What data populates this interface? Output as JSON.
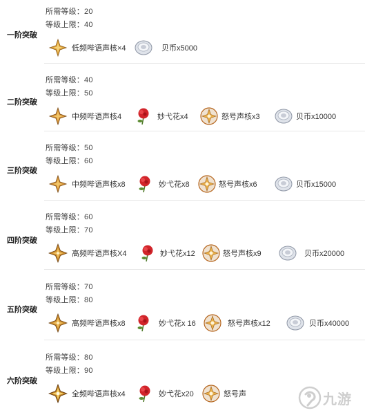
{
  "labels": {
    "level_prefix": "所需等级：",
    "cap_prefix": "等级上限："
  },
  "stages": [
    {
      "title": "一阶突破",
      "level": "所需等级：20",
      "cap": "等级上限：40",
      "materials": [
        {
          "icon": "low-echo-core-icon",
          "label": "低频哔语声核×4"
        },
        {
          "icon": "shell-coin-icon",
          "label": "贝币x5000"
        }
      ]
    },
    {
      "title": "二阶突破",
      "level": "所需等级：40",
      "cap": "等级上限：50",
      "materials": [
        {
          "icon": "mid-echo-core-icon",
          "label": "中频哔语声核4"
        },
        {
          "icon": "flower-icon",
          "label": "妙弋花x4"
        },
        {
          "icon": "roar-core-icon",
          "label": "怒号声核x3"
        },
        {
          "icon": "shell-coin-icon",
          "label": "贝币x10000"
        }
      ]
    },
    {
      "title": "三阶突破",
      "level": "所需等级：50",
      "cap": "等级上限：60",
      "materials": [
        {
          "icon": "mid-echo-core-icon",
          "label": "中频哔语声核x8"
        },
        {
          "icon": "flower-icon",
          "label": "妙弋花x8"
        },
        {
          "icon": "roar-core-icon",
          "label": "怒号声核x6"
        },
        {
          "icon": "shell-coin-icon",
          "label": "贝币x15000"
        }
      ]
    },
    {
      "title": "四阶突破",
      "level": "所需等级：60",
      "cap": "等级上限：70",
      "materials": [
        {
          "icon": "high-echo-core-icon",
          "label": "高频哔语声核X4"
        },
        {
          "icon": "flower-icon",
          "label": "妙弋花x12"
        },
        {
          "icon": "roar-core-icon",
          "label": "怒号声核x9"
        },
        {
          "icon": "shell-coin-icon",
          "label": "贝币x20000"
        }
      ]
    },
    {
      "title": "五阶突破",
      "level": "所需等级：70",
      "cap": "等级上限：80",
      "materials": [
        {
          "icon": "high-echo-core-icon",
          "label": "高频哔语声核x8"
        },
        {
          "icon": "flower-icon",
          "label": "妙弋花x 16"
        },
        {
          "icon": "roar-core-icon",
          "label": "怒号声核x12"
        },
        {
          "icon": "shell-coin-icon",
          "label": "贝币x40000"
        }
      ]
    },
    {
      "title": "六阶突破",
      "level": "所需等级：80",
      "cap": "等级上限：90",
      "materials": [
        {
          "icon": "full-echo-core-icon",
          "label": "全频哔语声核x4"
        },
        {
          "icon": "flower-icon",
          "label": "妙弋花x20"
        },
        {
          "icon": "roar-core-icon",
          "label": "怒号声"
        }
      ]
    }
  ],
  "watermark": {
    "icon": "9you-logo-icon",
    "text": "九游"
  },
  "colors": {
    "divider": "#e7e7e7",
    "text": "#333333",
    "star_gold": "#e0a43a",
    "flower_red": "#d1242a",
    "coin_silver": "#c8ccd6"
  }
}
